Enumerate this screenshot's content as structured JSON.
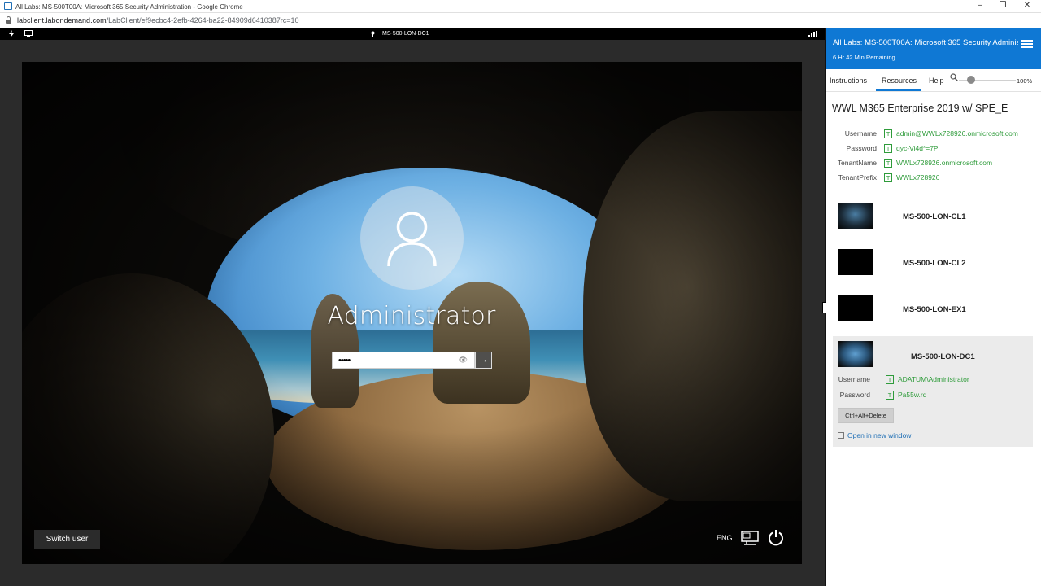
{
  "browser": {
    "window_title": "All Labs: MS-500T00A: Microsoft 365 Security Administration - Google Chrome",
    "url_host": "labclient.labondemand.com",
    "url_path": "/LabClient/ef9ecbc4-2efb-4264-ba22-84909d6410387rc=10",
    "controls": {
      "minimize": "–",
      "restore": "❐",
      "close": "✕"
    }
  },
  "vm_toolbar": {
    "vm_name": "MS-500-LON-DC1",
    "icons": [
      "power-icon",
      "monitor-icon",
      "signal-icon"
    ]
  },
  "lockscreen": {
    "user_name": "Administrator",
    "password_mask": "•••••",
    "reveal_glyph": "👁",
    "submit_glyph": "→",
    "switch_user_label": "Switch user",
    "language": "ENG"
  },
  "panel": {
    "title": "All Labs: MS-500T00A: Microsoft 365 Security Adminis",
    "time_remaining": "6 Hr 42 Min Remaining",
    "tabs": [
      {
        "label": "Instructions"
      },
      {
        "label": "Resources"
      },
      {
        "label": "Help"
      }
    ],
    "active_tab": "Resources",
    "zoom_value": "100%",
    "lab_name": "WWL M365 Enterprise 2019 w/ SPE_E",
    "credentials": [
      {
        "label": "Username",
        "value": "admin@WWLx728926.onmicrosoft.com"
      },
      {
        "label": "Password",
        "value": "qyc-Vi4d*=7P"
      },
      {
        "label": "TenantName",
        "value": "WWLx728926.onmicrosoft.com"
      },
      {
        "label": "TenantPrefix",
        "value": "WWLx728926"
      }
    ],
    "type_glyph": "T",
    "vms": [
      {
        "name": "MS-500-LON-CL1"
      },
      {
        "name": "MS-500-LON-CL2"
      },
      {
        "name": "MS-500-LON-EX1"
      },
      {
        "name": "MS-500-LON-DC1"
      }
    ],
    "active_vm": {
      "credentials": [
        {
          "label": "Username",
          "value": "ADATUM\\Administrator"
        },
        {
          "label": "Password",
          "value": "Pa55w.rd"
        }
      ],
      "ctrl_alt_delete_label": "Ctrl+Alt+Delete",
      "open_new_window_label": "Open in new window"
    },
    "accent_color": "#0f78d4",
    "credential_value_color": "#2e9b3a"
  }
}
